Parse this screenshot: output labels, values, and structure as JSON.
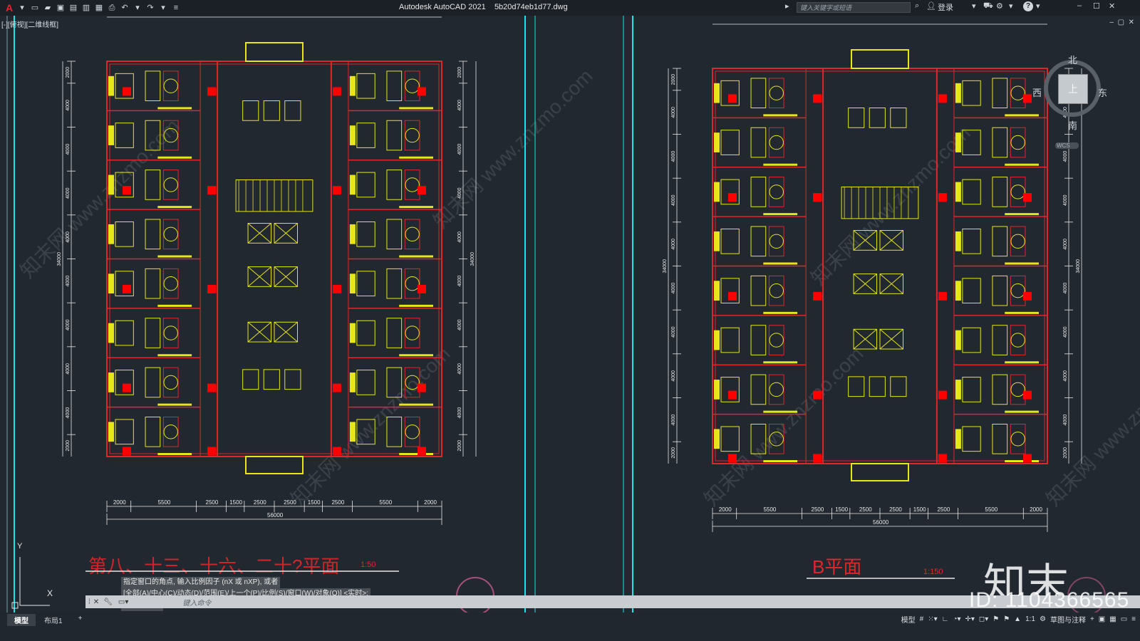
{
  "app": {
    "title": "Autodesk AutoCAD 2021",
    "file": "5b20d74eb1d77.dwg",
    "search_placeholder": "键入关键字或短语",
    "login": "登录",
    "help": "?"
  },
  "viewport": {
    "label": "[-][俯视][二维线框]",
    "compass": {
      "north": "北",
      "south": "南",
      "east": "东",
      "west": "西",
      "top": "上",
      "wcs": "WCS"
    }
  },
  "drawing_a": {
    "title": "第八、十三、十六、二十?平面",
    "scale": "1:50",
    "dims_bottom": [
      "2000",
      "5500",
      "2500",
      "1500",
      "2500",
      "2500",
      "1500",
      "2500",
      "5500",
      "2000"
    ],
    "dim_total": "56000",
    "dims_side": [
      "2000",
      "4000",
      "4000",
      "4000",
      "4000",
      "4000",
      "4000",
      "4000",
      "4000",
      "2000"
    ],
    "dim_side_total": "34000"
  },
  "drawing_b": {
    "title": "B平面",
    "scale": "1:150",
    "dims_bottom": [
      "2000",
      "5500",
      "2500",
      "1500",
      "2500",
      "2500",
      "1500",
      "2500",
      "5500",
      "2000"
    ],
    "dim_total": "56000",
    "dims_side": [
      "2000",
      "4000",
      "4000",
      "4000",
      "4000",
      "4000",
      "4000",
      "4000",
      "4000",
      "2000"
    ],
    "dim_side_total": "34000"
  },
  "command": {
    "history": [
      "指定窗口的角点, 输入比例因子 (nX 或 nXP), 或者",
      "[全部(A)/中心(C)/动态(D)/范围(E)/上一个(P)/比例(S)/窗口(W)/对象(O)] <实时>:",
      "指定对角点:"
    ],
    "input_placeholder": "键入命令"
  },
  "statusbar": {
    "tabs": [
      "模型",
      "布局1",
      "+"
    ],
    "model_label": "模型",
    "scale": "1:1",
    "workspace": "草图与注释"
  },
  "watermark": {
    "brand": "知末",
    "id": "ID: 1104366565",
    "site": "知末网 www.znzmo.com"
  },
  "colors": {
    "background": "#212830",
    "wall": "#e0262b",
    "fixture": "#e6e619",
    "column": "#ff0000",
    "accent_line": "#19e6e6"
  }
}
